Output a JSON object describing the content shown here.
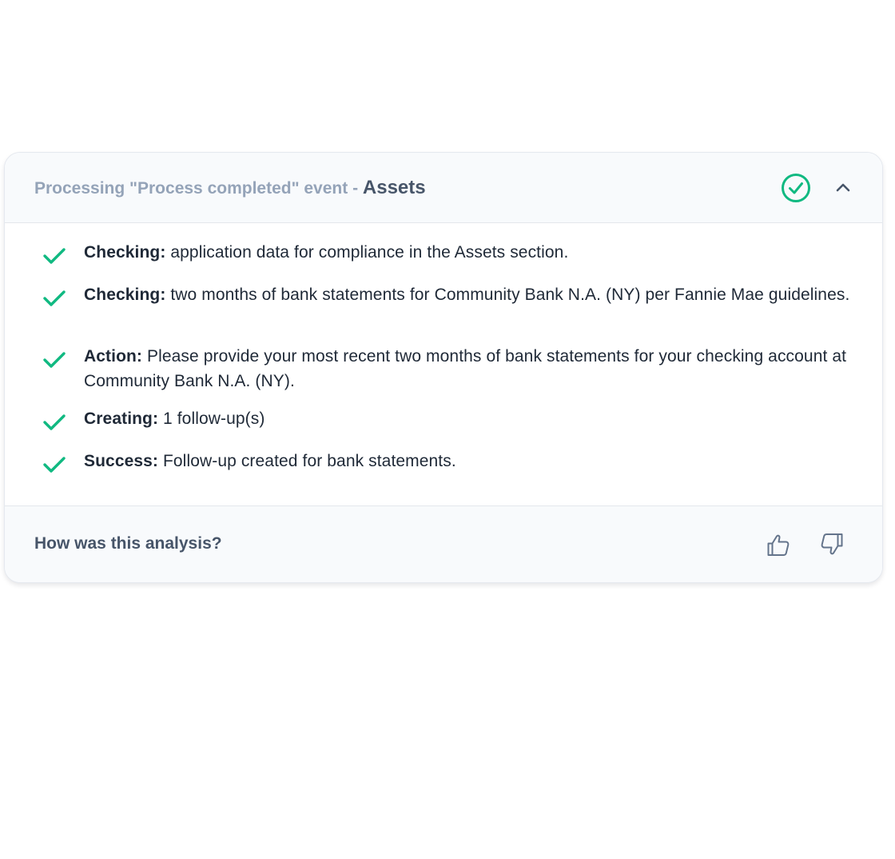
{
  "header": {
    "prefix": "Processing \"Process completed\" event - ",
    "section": "Assets",
    "status_icon": "check-circle-icon",
    "collapse_icon": "chevron-up-icon"
  },
  "steps": [
    {
      "label": "Checking:",
      "text": " application data for compliance in the Assets section."
    },
    {
      "label": "Checking:",
      "text": " two months of bank statements for Community Bank N.A. (NY) per Fannie Mae guidelines."
    },
    {
      "label": "Action:",
      "text": " Please provide your most recent two months of bank statements for your checking account at Community Bank N.A. (NY)."
    },
    {
      "label": "Creating:",
      "text": " 1 follow-up(s)"
    },
    {
      "label": "Success:",
      "text": " Follow-up created for bank statements."
    }
  ],
  "footer": {
    "question": "How was this analysis?",
    "thumbs_up_icon": "thumbs-up-icon",
    "thumbs_down_icon": "thumbs-down-icon"
  },
  "colors": {
    "success_green": "#10b981",
    "header_muted": "#94a3b8",
    "header_strong": "#475569",
    "body_text": "#1f2937"
  }
}
